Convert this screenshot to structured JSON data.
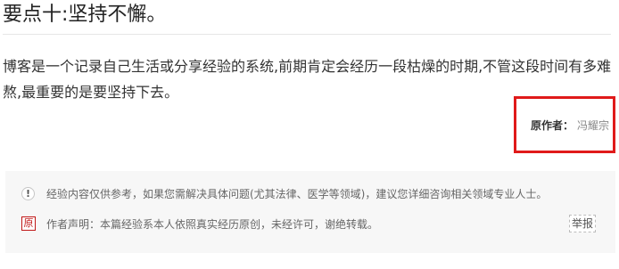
{
  "heading": {
    "title": "要点十:坚持不懈。"
  },
  "content": {
    "paragraph": "博客是一个记录自己生活或分享经验的系统,前期肯定会经历一段枯燥的时期,不管这段时间有多难熬,最重要的是要坚持下去。"
  },
  "author": {
    "label": "原作者：",
    "name": "冯耀宗"
  },
  "notices": {
    "disclaimer": {
      "icon": "!",
      "text": "经验内容仅供参考，如果您需解决具体问题(尤其法律、医学等领域)，建议您详细咨询相关领域专业人士。"
    },
    "statement": {
      "icon": "原",
      "text": "作者声明：本篇经验系本人依照真实经历原创，未经许可，谢绝转载。",
      "report_label": "举报"
    }
  },
  "colors": {
    "highlight_border": "#e01a1a",
    "original_badge": "#c01616",
    "panel_background": "#f7f7f7"
  }
}
